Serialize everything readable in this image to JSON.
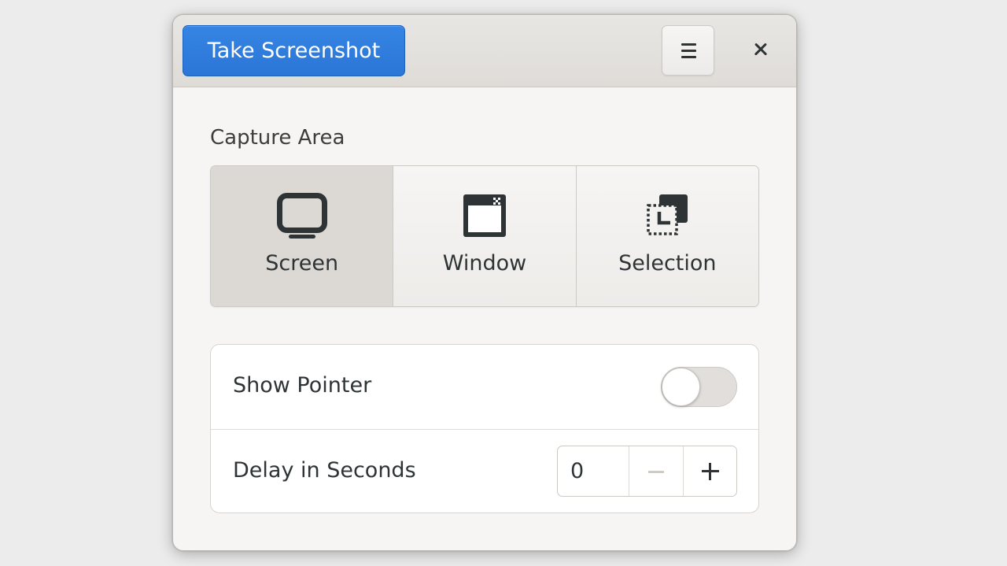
{
  "headerbar": {
    "take_screenshot_label": "Take Screenshot",
    "menu_icon": "hamburger-menu-icon",
    "close_icon": "close-icon"
  },
  "capture_area": {
    "title": "Capture Area",
    "selected": "Screen",
    "modes": [
      {
        "label": "Screen",
        "icon": "monitor-icon"
      },
      {
        "label": "Window",
        "icon": "window-icon"
      },
      {
        "label": "Selection",
        "icon": "selection-icon"
      }
    ]
  },
  "options": {
    "show_pointer": {
      "label": "Show Pointer",
      "value": false
    },
    "delay": {
      "label": "Delay in Seconds",
      "value": "0"
    }
  },
  "colors": {
    "accent": "#3584e4",
    "window_bg": "#f6f5f4",
    "text": "#2e3436"
  }
}
